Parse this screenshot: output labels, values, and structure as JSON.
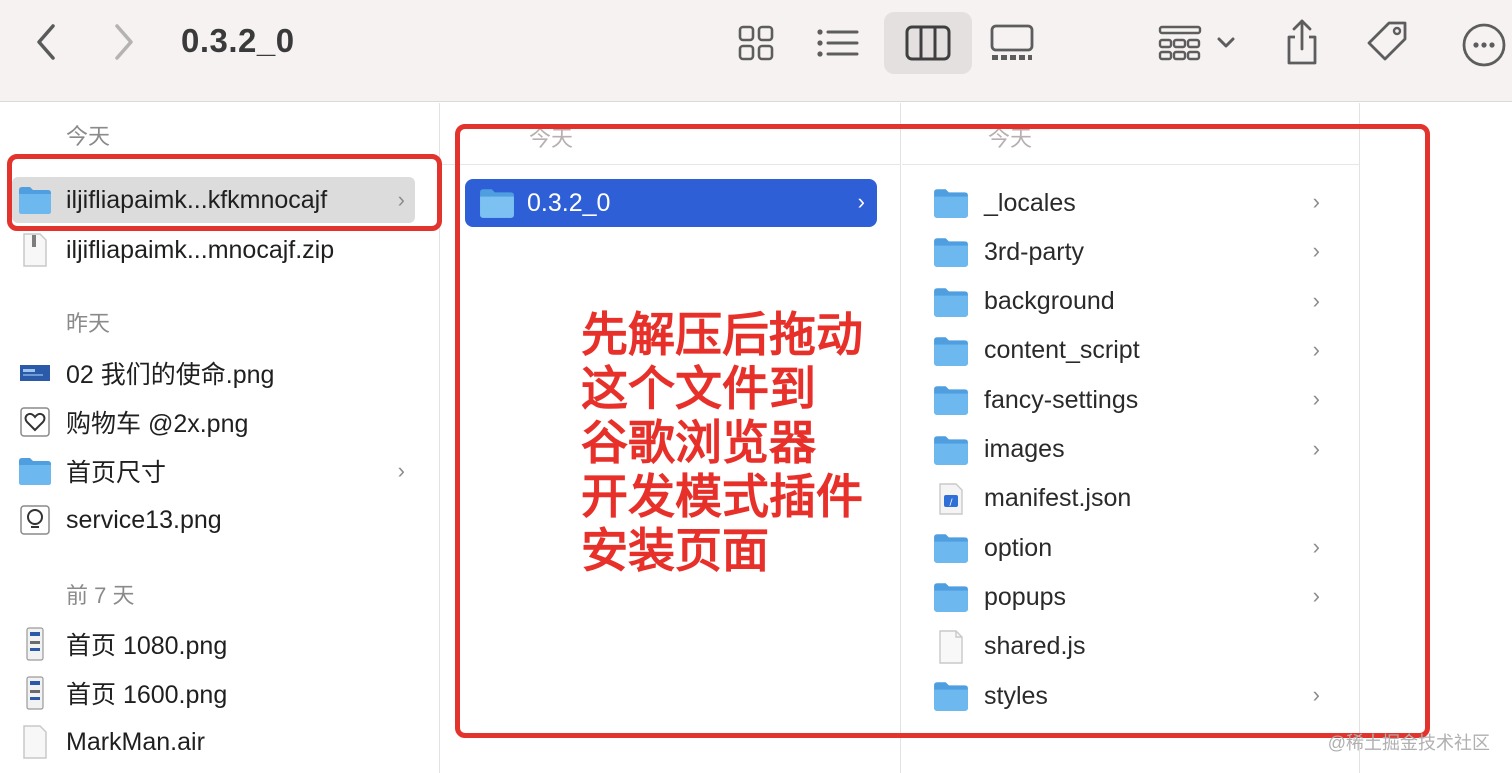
{
  "toolbar": {
    "title": "0.3.2_0",
    "back_icon": "chevron-left-icon",
    "forward_icon": "chevron-right-icon",
    "view_modes": [
      "icons-view-icon",
      "list-view-icon",
      "columns-view-icon",
      "gallery-view-icon"
    ],
    "active_view": "columns-view-icon",
    "actions": [
      "group-icon",
      "share-icon",
      "tag-icon",
      "more-icon"
    ]
  },
  "column1": {
    "sections": [
      {
        "heading": "今天",
        "items": [
          {
            "label": "iljifliapaimk...kfkmnocajf",
            "icon": "folder-icon",
            "selected": true,
            "has_children": true
          },
          {
            "label": "iljifliapaimk...mnocajf.zip",
            "icon": "zip-file-icon",
            "selected": false,
            "has_children": false
          }
        ]
      },
      {
        "heading": "昨天",
        "items": [
          {
            "label": "02 我们的使命.png",
            "icon": "image-thumbnail-icon",
            "has_children": false
          },
          {
            "label": "购物车 @2x.png",
            "icon": "heart-image-icon",
            "has_children": false
          },
          {
            "label": "首页尺寸",
            "icon": "folder-icon",
            "has_children": true
          },
          {
            "label": "service13.png",
            "icon": "bulb-image-icon",
            "has_children": false
          }
        ]
      },
      {
        "heading": "前 7 天",
        "items": [
          {
            "label": "首页 1080.png",
            "icon": "phone-image-icon",
            "has_children": false
          },
          {
            "label": "首页 1600.png",
            "icon": "phone-image-icon",
            "has_children": false
          },
          {
            "label": "MarkMan.air",
            "icon": "document-icon",
            "has_children": false
          }
        ]
      }
    ]
  },
  "column2": {
    "heading": "今天",
    "selected_item": {
      "label": "0.3.2_0",
      "icon": "folder-icon"
    },
    "annotation": "先解压后拖动\n这个文件到\n谷歌浏览器\n开发模式插件\n安装页面"
  },
  "column3": {
    "heading": "今天",
    "items": [
      {
        "label": "_locales",
        "icon": "folder-icon",
        "has_children": true
      },
      {
        "label": "3rd-party",
        "icon": "folder-icon",
        "has_children": true
      },
      {
        "label": "background",
        "icon": "folder-icon",
        "has_children": true
      },
      {
        "label": "content_script",
        "icon": "folder-icon",
        "has_children": true
      },
      {
        "label": "fancy-settings",
        "icon": "folder-icon",
        "has_children": true
      },
      {
        "label": "images",
        "icon": "folder-icon",
        "has_children": true
      },
      {
        "label": "manifest.json",
        "icon": "json-file-icon",
        "has_children": false
      },
      {
        "label": "option",
        "icon": "folder-icon",
        "has_children": true
      },
      {
        "label": "popups",
        "icon": "folder-icon",
        "has_children": true
      },
      {
        "label": "shared.js",
        "icon": "document-icon",
        "has_children": false
      },
      {
        "label": "styles",
        "icon": "folder-icon",
        "has_children": true
      }
    ]
  },
  "watermark": "@稀土掘金技术社区",
  "colors": {
    "selection": "#2f5fd6",
    "annotation": "#e8302a",
    "folder": "#5aaee8"
  }
}
